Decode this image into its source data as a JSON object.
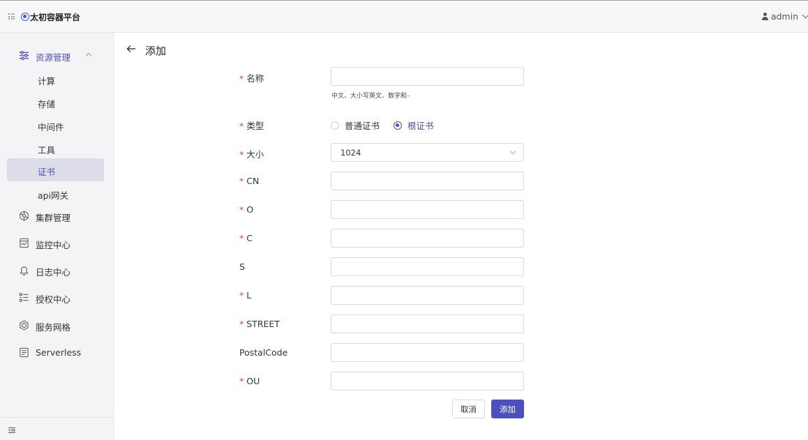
{
  "header": {
    "app_title": "太初容器平台",
    "user_name": "admin"
  },
  "sidebar": {
    "groups": [
      {
        "label": "资源管理",
        "icon": "sliders-icon",
        "expanded": true
      },
      {
        "label": "集群管理",
        "icon": "cluster-icon"
      },
      {
        "label": "监控中心",
        "icon": "monitor-icon"
      },
      {
        "label": "日志中心",
        "icon": "bell-icon"
      },
      {
        "label": "授权中心",
        "icon": "list-icon"
      },
      {
        "label": "服务网格",
        "icon": "mesh-icon"
      },
      {
        "label": "Serverless",
        "icon": "function-icon"
      }
    ],
    "sub_items": [
      {
        "label": "计算"
      },
      {
        "label": "存储"
      },
      {
        "label": "中间件"
      },
      {
        "label": "工具"
      },
      {
        "label": "证书",
        "selected": true
      },
      {
        "label": "api网关"
      }
    ]
  },
  "page": {
    "title": "添加"
  },
  "form": {
    "name": {
      "label": "名称",
      "required": true,
      "value": "",
      "hint": "中文、大小写英文、数字和–"
    },
    "type": {
      "label": "类型",
      "required": true,
      "options": [
        "普通证书",
        "根证书"
      ],
      "selected": "根证书"
    },
    "size": {
      "label": "大小",
      "required": true,
      "value": "1024"
    },
    "cn": {
      "label": "CN",
      "required": true,
      "value": ""
    },
    "o": {
      "label": "O",
      "required": true,
      "value": ""
    },
    "c": {
      "label": "C",
      "required": true,
      "value": ""
    },
    "s": {
      "label": "S",
      "required": false,
      "value": ""
    },
    "l": {
      "label": "L",
      "required": true,
      "value": ""
    },
    "street": {
      "label": "STREET",
      "required": true,
      "value": ""
    },
    "postal_code": {
      "label": "PostalCode",
      "required": false,
      "value": ""
    },
    "ou": {
      "label": "OU",
      "required": true,
      "value": ""
    },
    "required_mark": "*",
    "cancel_label": "取消",
    "submit_label": "添加"
  },
  "colors": {
    "accent": "#4b4fc0",
    "required": "#e0443a",
    "selected_bg": "#dcdde8"
  }
}
